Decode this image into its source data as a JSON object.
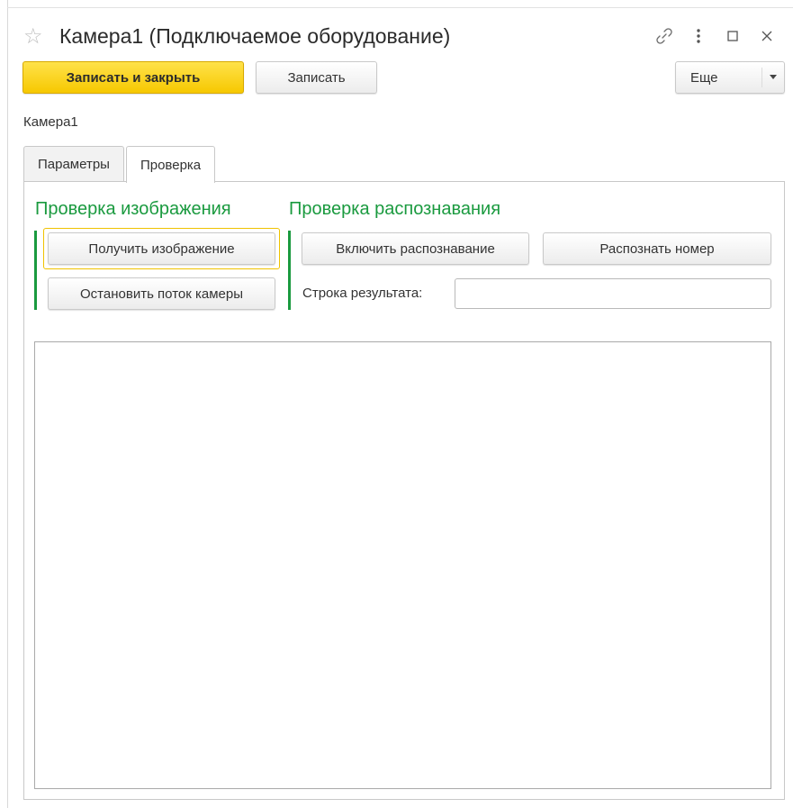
{
  "window": {
    "title": "Камера1 (Подключаемое оборудование)",
    "icons": [
      "star-icon",
      "link-icon",
      "more-vertical-icon",
      "maximize-icon",
      "close-icon"
    ]
  },
  "toolbar": {
    "save_close_label": "Записать и закрыть",
    "save_label": "Записать",
    "more_label": "Еще"
  },
  "record": {
    "name": "Камера1"
  },
  "tabs": [
    {
      "label": "Параметры",
      "active": false
    },
    {
      "label": "Проверка",
      "active": true
    }
  ],
  "image_check": {
    "title": "Проверка изображения",
    "get_image_label": "Получить изображение",
    "stop_stream_label": "Остановить поток камеры"
  },
  "recognition_check": {
    "title": "Проверка распознавания",
    "enable_label": "Включить распознавание",
    "recognize_label": "Распознать номер",
    "result_label": "Строка результата:",
    "result_value": ""
  },
  "colors": {
    "accent_green": "#1a9a3f",
    "primary_yellow": "#f6c800",
    "focus_yellow": "#f0c200"
  }
}
